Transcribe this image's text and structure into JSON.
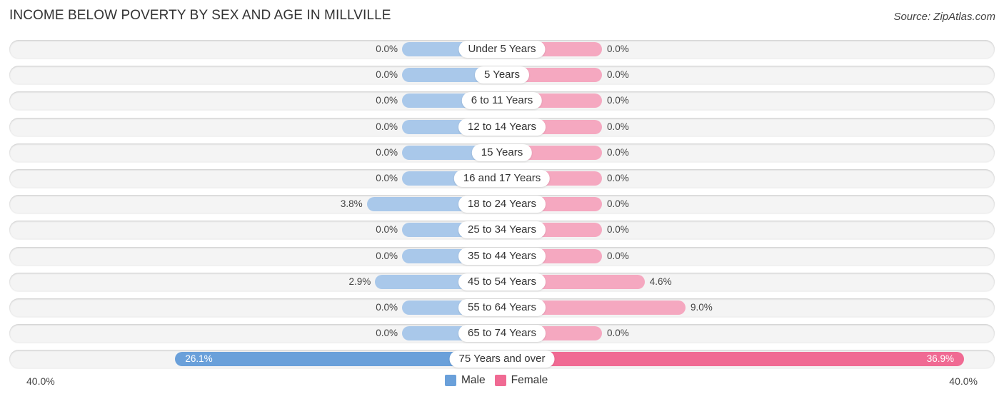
{
  "title": "INCOME BELOW POVERTY BY SEX AND AGE IN MILLVILLE",
  "source": "Source: ZipAtlas.com",
  "colors": {
    "male": "#a9c8ea",
    "male_highlight": "#6aa0da",
    "female": "#f5a8c0",
    "female_highlight": "#f06a93"
  },
  "chart_data": {
    "type": "bar",
    "orientation": "horizontal-diverging",
    "title": "INCOME BELOW POVERTY BY SEX AND AGE IN MILLVILLE",
    "categories": [
      "Under 5 Years",
      "5 Years",
      "6 to 11 Years",
      "12 to 14 Years",
      "15 Years",
      "16 and 17 Years",
      "18 to 24 Years",
      "25 to 34 Years",
      "35 to 44 Years",
      "45 to 54 Years",
      "55 to 64 Years",
      "65 to 74 Years",
      "75 Years and over"
    ],
    "series": [
      {
        "name": "Male",
        "values": [
          0.0,
          0.0,
          0.0,
          0.0,
          0.0,
          0.0,
          3.8,
          0.0,
          0.0,
          2.9,
          0.0,
          0.0,
          26.1
        ]
      },
      {
        "name": "Female",
        "values": [
          0.0,
          0.0,
          0.0,
          0.0,
          0.0,
          0.0,
          0.0,
          0.0,
          0.0,
          4.6,
          9.0,
          0.0,
          36.9
        ]
      }
    ],
    "value_labels": {
      "Male": [
        "0.0%",
        "0.0%",
        "0.0%",
        "0.0%",
        "0.0%",
        "0.0%",
        "3.8%",
        "0.0%",
        "0.0%",
        "2.9%",
        "0.0%",
        "0.0%",
        "26.1%"
      ],
      "Female": [
        "0.0%",
        "0.0%",
        "0.0%",
        "0.0%",
        "0.0%",
        "0.0%",
        "0.0%",
        "0.0%",
        "0.0%",
        "4.6%",
        "9.0%",
        "0.0%",
        "36.9%"
      ]
    },
    "xlim": [
      -40,
      40
    ],
    "axis_labels": {
      "left": "40.0%",
      "right": "40.0%"
    },
    "unit": "%",
    "legend": {
      "position": "bottom-center",
      "entries": [
        "Male",
        "Female"
      ]
    },
    "grid": false
  }
}
